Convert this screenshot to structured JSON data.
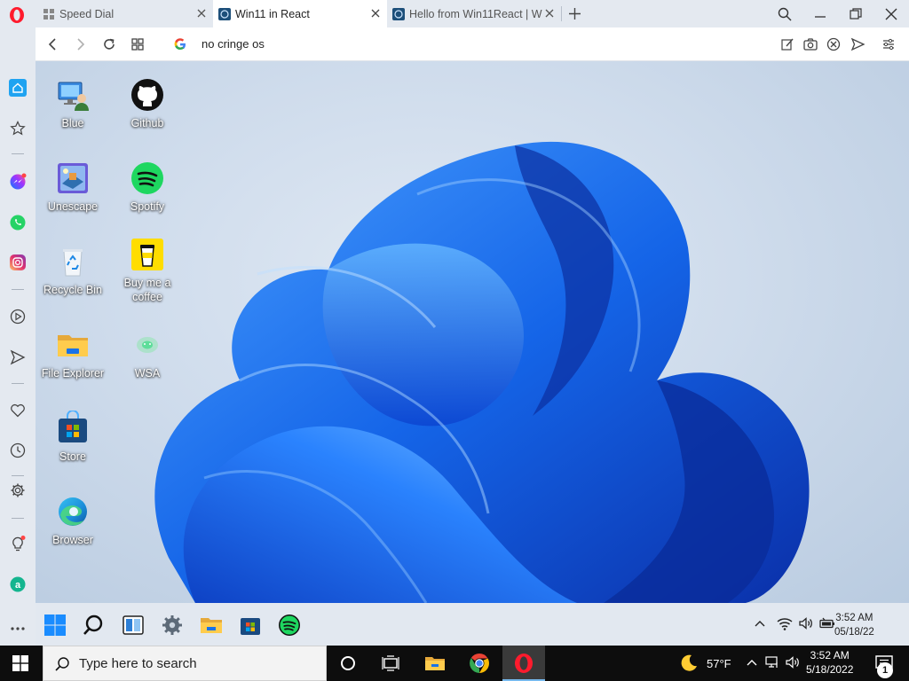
{
  "browser": {
    "tabs": [
      {
        "title": "Speed Dial",
        "active": false
      },
      {
        "title": "Win11 in React",
        "active": true
      },
      {
        "title": "Hello from Win11React | W",
        "active": false
      }
    ],
    "address": "no cringe os"
  },
  "desktop": {
    "icons": [
      {
        "label": "Blue",
        "icon": "monitor-user-icon"
      },
      {
        "label": "Github",
        "icon": "github-icon"
      },
      {
        "label": "Unescape",
        "icon": "unescape-game-icon"
      },
      {
        "label": "Spotify",
        "icon": "spotify-icon"
      },
      {
        "label": "Recycle Bin",
        "icon": "recycle-bin-icon"
      },
      {
        "label": "Buy me a coffee",
        "icon": "coffee-cup-icon"
      },
      {
        "label": "File Explorer",
        "icon": "folder-icon"
      },
      {
        "label": "WSA",
        "icon": "wsa-icon"
      },
      {
        "label": "Store",
        "icon": "store-icon"
      },
      {
        "label": "Browser",
        "icon": "edge-icon"
      }
    ]
  },
  "win11_taskbar": {
    "time": "3:52 AM",
    "date": "05/18/22"
  },
  "host_taskbar": {
    "search_placeholder": "Type here to search",
    "weather": "57°F",
    "time": "3:52 AM",
    "date": "5/18/2022",
    "notification_count": "1"
  },
  "colors": {
    "win11_blue": "#1565e8",
    "opera_red": "#ff1b2d",
    "spotify_green": "#1ed760",
    "active_sidebar": "#1fa3f1"
  }
}
